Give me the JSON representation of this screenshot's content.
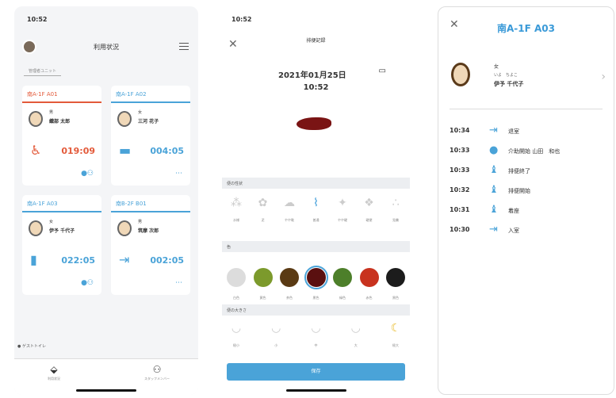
{
  "panel1": {
    "time": "10:52",
    "title": "利用状況",
    "tab": "管理者ユニット",
    "bottom_label": "● ゲストトイレ",
    "cards": [
      {
        "name": "南A-1F A01",
        "gender": "男",
        "person": "織部 太郎",
        "timer": "019:09",
        "icon": "♿"
      },
      {
        "name": "南A-1F A02",
        "gender": "女",
        "person": "三河 花子",
        "timer": "004:05",
        "icon": "▬"
      },
      {
        "name": "南A-1F A03",
        "gender": "女",
        "person": "伊予 千代子",
        "timer": "022:05",
        "icon": "▮"
      },
      {
        "name": "南B-2F B01",
        "gender": "男",
        "person": "筑摩 次郎",
        "timer": "002:05",
        "icon": "⇥"
      }
    ],
    "nav": [
      {
        "icon": "⬙",
        "label": "利用状況"
      },
      {
        "icon": "⚇",
        "label": "スタッフメンバー"
      }
    ]
  },
  "panel2": {
    "time": "10:52",
    "title": "排便記録",
    "date": "2021年01月25日",
    "clock": "10:52",
    "sec_shape": "便の性状",
    "sec_color": "色",
    "sec_size": "便の大きさ",
    "shapes": [
      "水様",
      "泥",
      "やや軟",
      "普通",
      "やや硬",
      "硬便",
      "兎糞"
    ],
    "colors": [
      {
        "hex": "#dcdcdc",
        "label": "白色"
      },
      {
        "hex": "#7c9a2c",
        "label": "黄色"
      },
      {
        "hex": "#5a3a14",
        "label": "茶色"
      },
      {
        "hex": "#5a1010",
        "label": "黒色"
      },
      {
        "hex": "#4d7f2a",
        "label": "緑色"
      },
      {
        "hex": "#c8321e",
        "label": "赤色"
      },
      {
        "hex": "#1c1c1c",
        "label": "黒色"
      }
    ],
    "sizes": [
      "極小",
      "小",
      "中",
      "大",
      "極大"
    ],
    "save": "保存"
  },
  "panel3": {
    "title": "南A-1F A03",
    "gender": "女",
    "kana": "いよ　ちよこ",
    "name": "伊予 千代子",
    "events": [
      {
        "t": "10:34",
        "icon": "⇥",
        "a": "退室"
      },
      {
        "t": "10:33",
        "icon": "●",
        "a": "介助開始 山田　和也"
      },
      {
        "t": "10:33",
        "icon": "♝",
        "a": "排便終了"
      },
      {
        "t": "10:32",
        "icon": "♝",
        "a": "排便開始"
      },
      {
        "t": "10:31",
        "icon": "♝",
        "a": "着座"
      },
      {
        "t": "10:30",
        "icon": "⇥",
        "a": "入室"
      }
    ]
  }
}
